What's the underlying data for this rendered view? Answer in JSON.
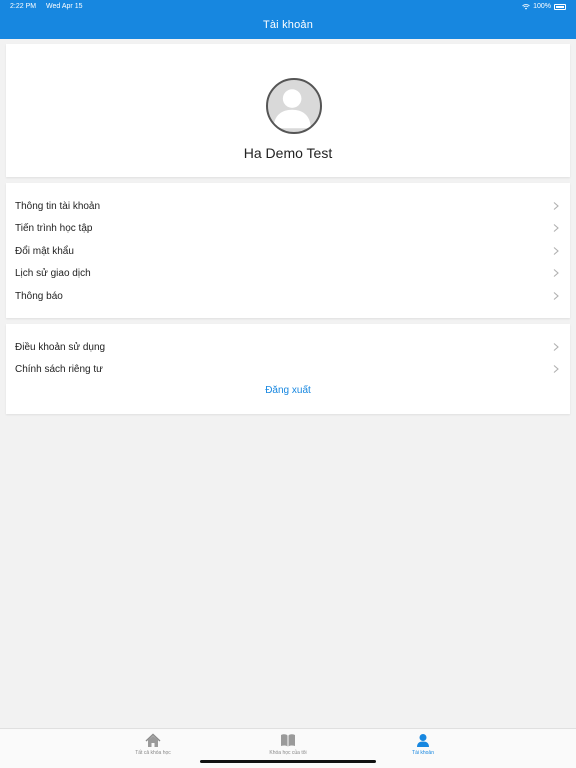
{
  "status_bar": {
    "time": "2:22 PM",
    "date": "Wed Apr 15",
    "battery": "100%"
  },
  "header": {
    "title": "Tài khoản"
  },
  "profile": {
    "name": "Ha Demo Test"
  },
  "menu_group_1": [
    {
      "label": "Thông tin tài khoản"
    },
    {
      "label": "Tiến trình học tập"
    },
    {
      "label": "Đổi mật khẩu"
    },
    {
      "label": "Lịch sử giao dịch"
    },
    {
      "label": "Thông báo"
    }
  ],
  "menu_group_2": [
    {
      "label": "Điều khoản sử dụng"
    },
    {
      "label": "Chính sách riêng tư"
    }
  ],
  "logout_label": "Đăng xuất",
  "tabs": [
    {
      "label": "Tất cả khóa học",
      "icon": "home-icon"
    },
    {
      "label": "Khóa học của tôi",
      "icon": "book-icon"
    },
    {
      "label": "Tài khoản",
      "icon": "user-icon"
    }
  ],
  "colors": {
    "accent": "#1787e0",
    "background": "#f2f2f2"
  }
}
